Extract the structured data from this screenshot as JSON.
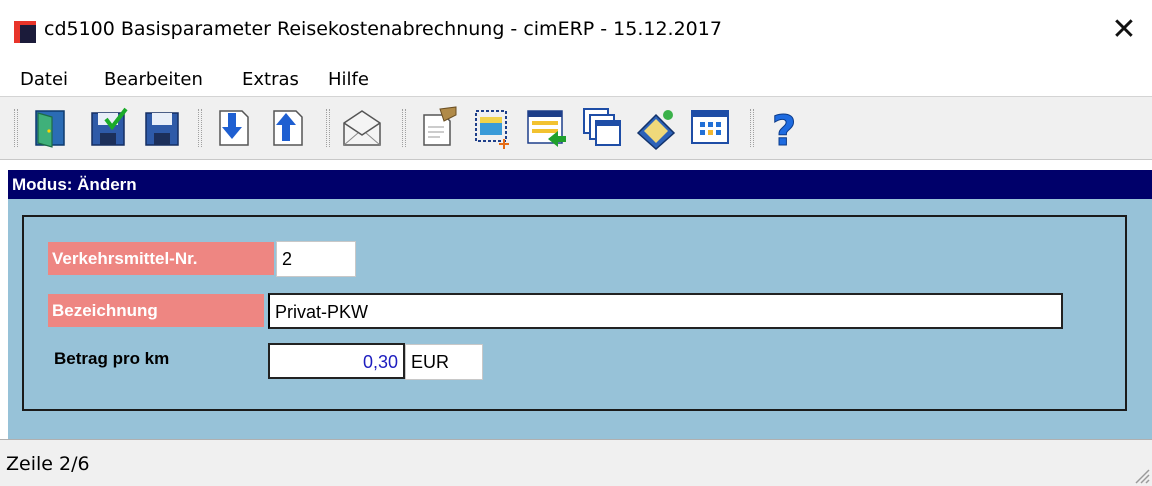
{
  "window": {
    "title": "cd5100 Basisparameter Reisekostenabrechnung - cimERP - 15.12.2017",
    "close_glyph": "✕"
  },
  "menu": [
    {
      "label": "Datei"
    },
    {
      "label": "Bearbeiten"
    },
    {
      "label": "Extras"
    },
    {
      "label": "Hilfe"
    }
  ],
  "toolbar": {
    "buttons": [
      {
        "icon": "exit-door-icon"
      },
      {
        "icon": "save-check-icon"
      },
      {
        "icon": "save-icon"
      },
      {
        "icon": "arrow-down-document-icon"
      },
      {
        "icon": "arrow-up-document-icon"
      },
      {
        "icon": "envelope-icon"
      },
      {
        "icon": "edit-document-icon"
      },
      {
        "icon": "new-selection-icon"
      },
      {
        "icon": "list-arrow-icon"
      },
      {
        "icon": "windows-icon"
      },
      {
        "icon": "book-tag-icon"
      },
      {
        "icon": "calendar-grid-icon"
      },
      {
        "icon": "help-icon"
      }
    ]
  },
  "mode": {
    "label": "Modus: Ändern"
  },
  "form": {
    "verkehrsmittel_label": "Verkehrsmittel-Nr.",
    "verkehrsmittel_value": "2",
    "bezeichnung_label": "Bezeichnung",
    "bezeichnung_value": "Privat-PKW",
    "betrag_label": "Betrag pro km",
    "betrag_value": "0,30",
    "currency_value": "EUR"
  },
  "status": {
    "text": "Zeile 2/6"
  },
  "colors": {
    "mode_bar": "#00006a",
    "panel_bg": "#97c2d8",
    "required_label_bg": "#ee8682",
    "number_text": "#1d1dbf"
  }
}
